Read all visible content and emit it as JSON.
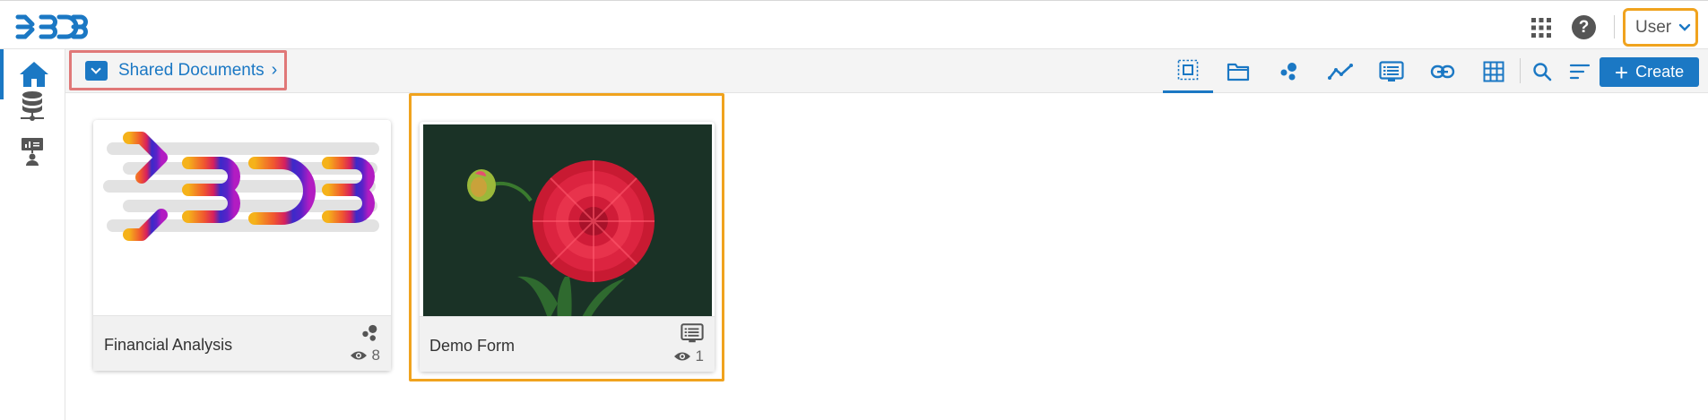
{
  "header": {
    "logo_alt": "BDB",
    "apps_icon": "apps-grid-icon",
    "help_icon": "help-icon",
    "help_label": "?",
    "user_label": "User"
  },
  "sidebar": {
    "items": [
      {
        "icon": "home-icon",
        "active": true
      },
      {
        "icon": "database-icon",
        "active": false
      },
      {
        "icon": "presentation-user-icon",
        "active": false
      }
    ]
  },
  "breadcrumb": {
    "label": "Shared Documents",
    "chevron": "›"
  },
  "toolbar": {
    "tools": [
      {
        "icon": "select-all-icon",
        "active": true
      },
      {
        "icon": "folder-icon"
      },
      {
        "icon": "scatter-icon"
      },
      {
        "icon": "line-chart-icon"
      },
      {
        "icon": "form-icon"
      },
      {
        "icon": "link-icon"
      },
      {
        "icon": "table-icon"
      }
    ],
    "search_icon": "search-icon",
    "sort_icon": "sort-icon",
    "create_plus": "+",
    "create_label": "Create",
    "accent": "#1b78c4"
  },
  "cards": [
    {
      "title": "Financial Analysis",
      "views": "8",
      "type_icon": "scatter-icon",
      "thumbnail": "bdb-logo"
    },
    {
      "title": "Demo Form",
      "views": "1",
      "type_icon": "form-icon",
      "thumbnail": "red-dahlia-flower"
    }
  ]
}
